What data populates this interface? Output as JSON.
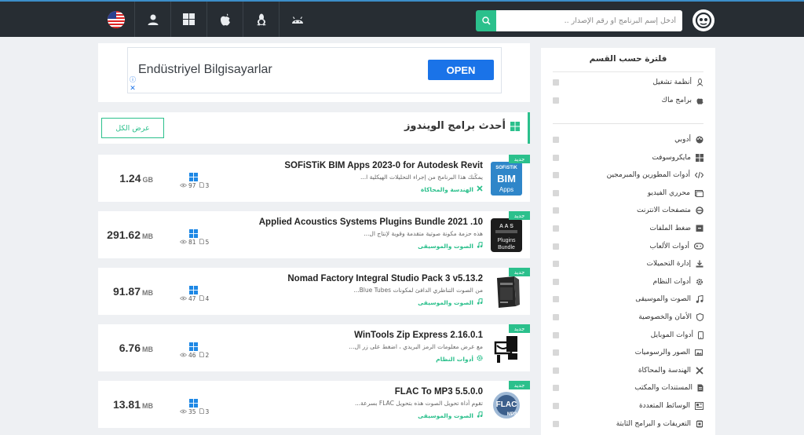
{
  "topbar": {
    "search_placeholder": "أدخل إسم البرنامج او رقم الإصدار ..",
    "os_icons": [
      "usa-flag-icon",
      "user-icon",
      "windows-icon",
      "apple-icon",
      "linux-icon",
      "android-icon"
    ]
  },
  "ad": {
    "text": "Endüstriyel Bilgisayarlar",
    "button": "OPEN"
  },
  "section": {
    "title": "أحدث برامج الويندوز",
    "view_all": "عرض الكل",
    "badge": "جديد"
  },
  "programs": [
    {
      "title": "SOFiSTiK BIM Apps 2023-0 for Autodesk Revit",
      "desc": "يمكّنك هذا البرنامج من إجراء التحليلات الهيكلية ا...",
      "category": "الهندسة والمحاكاة",
      "size": "1.24",
      "unit": "GB",
      "views": "97",
      "files": "3",
      "thumb_lines": [
        "SOFiSTiK",
        "BIM",
        "Apps"
      ]
    },
    {
      "title": "Applied Acoustics Systems Plugins Bundle 2021 .10",
      "desc": "هذه حزمة مكونة صوتية متقدمة وقوية لإنتاج ال...",
      "category": "الصوت والموسيقى",
      "size": "291.62",
      "unit": "MB",
      "views": "81",
      "files": "5",
      "thumb_lines": [
        "A A S",
        "Plugins",
        "Bundle"
      ]
    },
    {
      "title": "Nomad Factory Integral Studio Pack 3 v5.13.2",
      "desc": "من الصوت التناظري الدافئ لمكونات Blue Tubes...",
      "category": "الصوت والموسيقى",
      "size": "91.87",
      "unit": "MB",
      "views": "47",
      "files": "4",
      "thumb_lines": []
    },
    {
      "title": "WinTools Zip Express 2.16.0.1",
      "desc": "مع عرض معلومات الرمز البريدي ، اضغط على زر ال...",
      "category": "أدوات النظام",
      "size": "6.76",
      "unit": "MB",
      "views": "46",
      "files": "2",
      "thumb_lines": []
    },
    {
      "title": "FLAC To MP3 5.5.0.0",
      "desc": "تقوم أداة تحويل الصوت هذه بتحويل FLAC بسرعة...",
      "category": "الصوت والموسيقى",
      "size": "13.81",
      "unit": "MB",
      "views": "35",
      "files": "3",
      "thumb_lines": [
        "FLAC",
        "MP3"
      ]
    }
  ],
  "sidebar": {
    "title": "فلترة حسب القسم",
    "os_items": [
      "أنظمة تشغيل",
      "برامج ماك"
    ],
    "categories": [
      "أدوبي",
      "مايكروسوفت",
      "أدوات المطورين والمبرمجين",
      "محرري الفيديو",
      "متصفحات الانترنت",
      "ضغط الملفات",
      "أدوات الألعاب",
      "إدارة التحميلات",
      "أدوات النظام",
      "الصوت والموسيقى",
      "الأمان والخصوصية",
      "أدوات الموبايل",
      "الصور والرسوميات",
      "الهندسة والمحاكاة",
      "المستندات والمكتب",
      "الوسائط المتعددة",
      "التعريفات و البرامج الثابتة"
    ]
  },
  "colors": {
    "topbar": "#272d33",
    "accent": "#2bc08c",
    "ad_button": "#1a73e8"
  }
}
